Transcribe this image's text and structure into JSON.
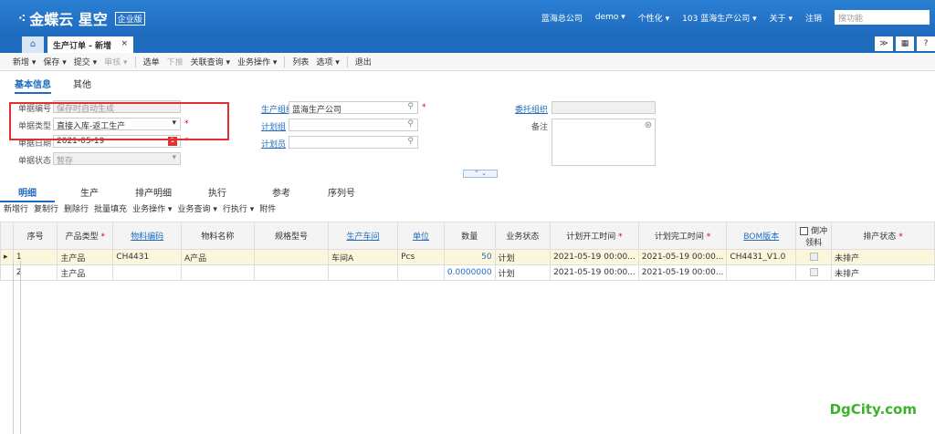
{
  "topbar": {
    "logo": "金蝶云 星空",
    "edition": "企业版",
    "org": "蓝海总公司",
    "user": "demo ▾",
    "personalize": "个性化 ▾",
    "company": "103 蓝海生产公司 ▾",
    "about": "关于 ▾",
    "logout": "注销",
    "search_placeholder": "搜功能"
  },
  "tabs": {
    "home_icon": "⌂",
    "current": "生产订单 - 新增",
    "close": "×"
  },
  "right_buttons": [
    "≫",
    "▦",
    "?"
  ],
  "toolbar": {
    "new": "新增 ▾",
    "save": "保存 ▾",
    "submit": "提交 ▾",
    "audit": "审核 ▾",
    "select": "选单",
    "push": "下推",
    "linked_query": "关联查询 ▾",
    "business_ops": "业务操作 ▾",
    "list": "列表",
    "options": "选项 ▾",
    "exit": "退出"
  },
  "subtabs": {
    "basic": "基本信息",
    "other": "其他"
  },
  "form": {
    "doc_no_label": "单据编号",
    "doc_no_placeholder": "保存时自动生成",
    "doc_type_label": "单据类型",
    "doc_type_value": "直接入库-返工生产",
    "doc_date_label": "单据日期",
    "doc_date_value": "2021-05-19",
    "doc_status_label": "单据状态",
    "doc_status_value": "暂存",
    "prod_org_label": "生产组织",
    "prod_org_value": "蓝海生产公司",
    "plan_group_label": "计划组",
    "planner_label": "计划员",
    "entrust_org_label": "委托组织",
    "remark_label": "备注",
    "req": "*"
  },
  "collapse_label": "⌃ ⌄",
  "detail_tabs": [
    "明细",
    "生产",
    "排产明细",
    "执行",
    "参考",
    "序列号"
  ],
  "detail_toolbar": [
    "新增行",
    "复制行",
    "删除行",
    "批量填充",
    "业务操作 ▾",
    "业务查询 ▾",
    "行执行 ▾",
    "附件"
  ],
  "table": {
    "headers": {
      "seq": "序号",
      "prod_type": "产品类型",
      "material_code": "物料编码",
      "material_name": "物料名称",
      "spec": "规格型号",
      "workshop": "生产车间",
      "unit": "单位",
      "qty": "数量",
      "biz_status": "业务状态",
      "plan_start": "计划开工时间",
      "plan_end": "计划完工时间",
      "bom": "BOM版本",
      "backflush": "倒冲领料",
      "schedule_status": "排产状态",
      "star": "*"
    },
    "rows": [
      {
        "seq": "1",
        "prod_type": "主产品",
        "material_code": "CH4431",
        "material_name": "A产品",
        "spec": "",
        "workshop": "车间A",
        "unit": "Pcs",
        "qty": "50",
        "biz_status": "计划",
        "plan_start": "2021-05-19 00:00...",
        "plan_end": "2021-05-19 00:00...",
        "bom": "CH4431_V1.0",
        "schedule_status": "未排产"
      },
      {
        "seq": "2",
        "prod_type": "主产品",
        "material_code": "",
        "material_name": "",
        "spec": "",
        "workshop": "",
        "unit": "",
        "qty": "0.0000000",
        "biz_status": "计划",
        "plan_start": "2021-05-19 00:00...",
        "plan_end": "2021-05-19 00:00...",
        "bom": "",
        "schedule_status": "未排产"
      }
    ]
  },
  "watermark": "DgCity.com",
  "colors": {
    "brand": "#1f6cbf",
    "required": "#dd0000",
    "highlight_box": "#e03030",
    "selected_row": "#fbf6dc"
  }
}
